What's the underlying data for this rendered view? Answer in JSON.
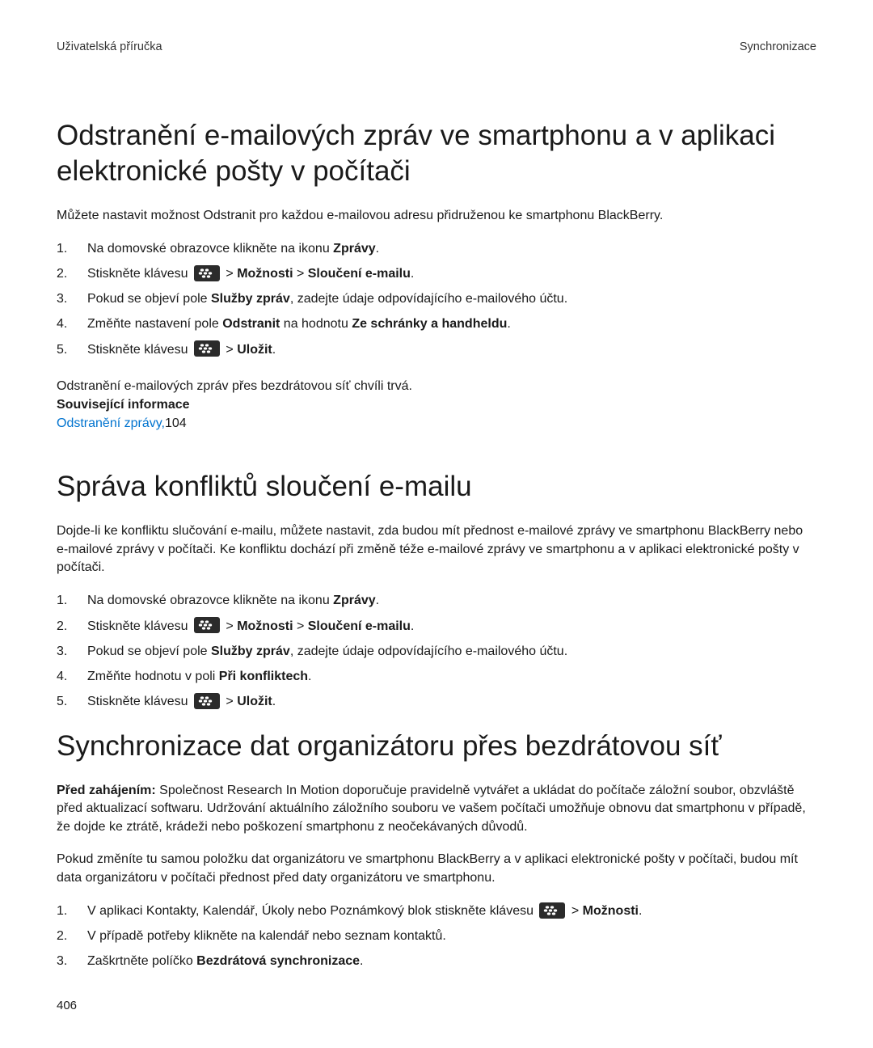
{
  "header": {
    "left": "Uživatelská příručka",
    "right": "Synchronizace"
  },
  "sec1": {
    "title": "Odstranění e-mailových zpráv ve smartphonu a v aplikaci elektronické pošty v počítači",
    "intro": "Můžete nastavit možnost Odstranit pro každou e-mailovou adresu přidruženou ke smartphonu BlackBerry.",
    "steps": [
      {
        "n": "1.",
        "pre": "Na domovské obrazovce klikněte na ikonu ",
        "b1": "Zprávy",
        "post": "."
      },
      {
        "n": "2.",
        "pre": "Stiskněte klávesu ",
        "icon": true,
        "sep1": " > ",
        "b1": "Možnosti",
        "sep2": " > ",
        "b2": "Sloučení e-mailu",
        "post": "."
      },
      {
        "n": "3.",
        "pre": "Pokud se objeví pole ",
        "b1": "Služby zpráv",
        "post": ", zadejte údaje odpovídajícího e-mailového účtu."
      },
      {
        "n": "4.",
        "pre": "Změňte nastavení pole ",
        "b1": "Odstranit",
        "mid": " na hodnotu ",
        "b2": "Ze schránky a handheldu",
        "post": "."
      },
      {
        "n": "5.",
        "pre": "Stiskněte klávesu ",
        "icon": true,
        "sep1": " > ",
        "b1": "Uložit",
        "post": "."
      }
    ],
    "note": "Odstranění e-mailových zpráv přes bezdrátovou síť chvíli trvá.",
    "related_label": "Související informace",
    "related_link": "Odstranění zprávy,",
    "related_page": "104"
  },
  "sec2": {
    "title": "Správa konfliktů sloučení e-mailu",
    "intro": "Dojde-li ke konfliktu slučování e-mailu, můžete nastavit, zda budou mít přednost e-mailové zprávy ve smartphonu BlackBerry nebo e-mailové zprávy v počítači. Ke konfliktu dochází při změně téže e-mailové zprávy ve smartphonu a v aplikaci elektronické pošty v počítači.",
    "steps": [
      {
        "n": "1.",
        "pre": "Na domovské obrazovce klikněte na ikonu ",
        "b1": "Zprávy",
        "post": "."
      },
      {
        "n": "2.",
        "pre": "Stiskněte klávesu ",
        "icon": true,
        "sep1": " > ",
        "b1": "Možnosti",
        "sep2": " > ",
        "b2": "Sloučení e-mailu",
        "post": "."
      },
      {
        "n": "3.",
        "pre": "Pokud se objeví pole ",
        "b1": "Služby zpráv",
        "post": ", zadejte údaje odpovídajícího e-mailového účtu."
      },
      {
        "n": "4.",
        "pre": "Změňte hodnotu v poli ",
        "b1": "Při konfliktech",
        "post": "."
      },
      {
        "n": "5.",
        "pre": "Stiskněte klávesu ",
        "icon": true,
        "sep1": " > ",
        "b1": "Uložit",
        "post": "."
      }
    ]
  },
  "sec3": {
    "title": "Synchronizace dat organizátoru přes bezdrátovou síť",
    "p1_bold": "Před zahájením: ",
    "p1": "Společnost Research In Motion doporučuje pravidelně vytvářet a ukládat do počítače záložní soubor, obzvláště před aktualizací softwaru. Udržování aktuálního záložního souboru ve vašem počítači umožňuje obnovu dat smartphonu v případě, že dojde ke ztrátě, krádeži nebo poškození smartphonu z neočekávaných důvodů.",
    "p2": "Pokud změníte tu samou položku dat organizátoru ve smartphonu BlackBerry a v aplikaci elektronické pošty v počítači, budou mít data organizátoru v počítači přednost před daty organizátoru ve smartphonu.",
    "steps": [
      {
        "n": "1.",
        "pre": "V aplikaci Kontakty, Kalendář, Úkoly nebo Poznámkový blok stiskněte klávesu ",
        "icon": true,
        "sep1": " > ",
        "b1": "Možnosti",
        "post": "."
      },
      {
        "n": "2.",
        "pre": "V případě potřeby klikněte na kalendář nebo seznam kontaktů.",
        "post": ""
      },
      {
        "n": "3.",
        "pre": "Zaškrtněte políčko ",
        "b1": "Bezdrátová synchronizace",
        "post": "."
      }
    ]
  },
  "page_number": "406"
}
